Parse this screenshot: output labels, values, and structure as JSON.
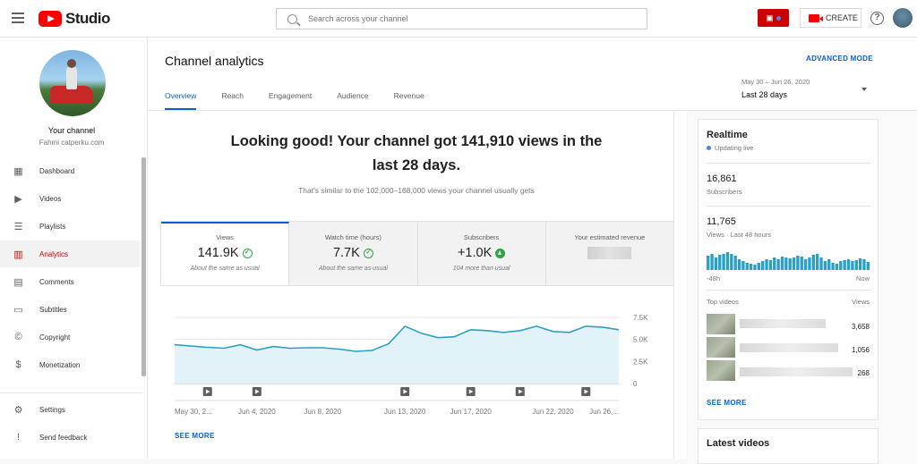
{
  "app": {
    "logo_text": "Studio"
  },
  "search": {
    "placeholder": "Search across your channel"
  },
  "header": {
    "create_label": "CREATE",
    "help_label": "?"
  },
  "sidebar": {
    "your_channel": "Your channel",
    "channel_name": "Fahmi catperku.com",
    "items": [
      {
        "label": "Dashboard",
        "icon": "dashboard-icon",
        "glyph": "▦"
      },
      {
        "label": "Videos",
        "icon": "videos-icon",
        "glyph": "▶"
      },
      {
        "label": "Playlists",
        "icon": "playlists-icon",
        "glyph": "☰"
      },
      {
        "label": "Analytics",
        "icon": "analytics-icon",
        "glyph": "▥",
        "active": true
      },
      {
        "label": "Comments",
        "icon": "comments-icon",
        "glyph": "▤"
      },
      {
        "label": "Subtitles",
        "icon": "subtitles-icon",
        "glyph": "▭"
      },
      {
        "label": "Copyright",
        "icon": "copyright-icon",
        "glyph": "©"
      },
      {
        "label": "Monetization",
        "icon": "monetization-icon",
        "glyph": "$"
      }
    ],
    "bottom_items": [
      {
        "label": "Settings",
        "icon": "settings-icon",
        "glyph": "⚙"
      },
      {
        "label": "Send feedback",
        "icon": "feedback-icon",
        "glyph": "!"
      }
    ]
  },
  "page": {
    "title": "Channel analytics",
    "advanced_mode": "ADVANCED MODE",
    "tabs": [
      "Overview",
      "Reach",
      "Engagement",
      "Audience",
      "Revenue"
    ],
    "date_range": "May 30 – Jun 26, 2020",
    "date_label": "Last 28 days"
  },
  "overview": {
    "headline": "Looking good! Your channel got 141,910 views in the last 28 days.",
    "subline": "That's similar to the 102,000–168,000 views your channel usually gets",
    "metrics": [
      {
        "label": "Views",
        "value": "141.9K",
        "note": "About the same as usual",
        "icon": "check-icon"
      },
      {
        "label": "Watch time (hours)",
        "value": "7.7K",
        "note": "About the same as usual",
        "icon": "check-icon"
      },
      {
        "label": "Subscribers",
        "value": "+1.0K",
        "note": "104 more than usual",
        "icon": "arrow-up-icon"
      },
      {
        "label": "Your estimated revenue",
        "value": "",
        "note": "",
        "icon": ""
      }
    ],
    "see_more": "SEE MORE"
  },
  "chart_data": {
    "type": "area",
    "x": [
      "May 30",
      "May 31",
      "Jun 1",
      "Jun 2",
      "Jun 3",
      "Jun 4",
      "Jun 5",
      "Jun 6",
      "Jun 7",
      "Jun 8",
      "Jun 9",
      "Jun 10",
      "Jun 11",
      "Jun 12",
      "Jun 13",
      "Jun 14",
      "Jun 15",
      "Jun 16",
      "Jun 17",
      "Jun 18",
      "Jun 19",
      "Jun 20",
      "Jun 21",
      "Jun 22",
      "Jun 23",
      "Jun 24",
      "Jun 25",
      "Jun 26"
    ],
    "values": [
      4400,
      4250,
      4100,
      4000,
      4400,
      3800,
      4200,
      4000,
      4050,
      4050,
      3900,
      3650,
      3750,
      4500,
      6500,
      5700,
      5200,
      5300,
      6100,
      6000,
      5800,
      6000,
      6500,
      5900,
      5800,
      6500,
      6400,
      6100
    ],
    "tick_labels_x": [
      "May 30, 2...",
      "Jun 4, 2020",
      "Jun 8, 2020",
      "Jun 13, 2020",
      "Jun 17, 2020",
      "Jun 22, 2020",
      "Jun 26,..."
    ],
    "tick_labels_y": [
      "7.5K",
      "5.0K",
      "2.5K",
      "0"
    ],
    "ylim": [
      0,
      7500
    ],
    "video_markers": [
      "Jun 1",
      "Jun 4",
      "Jun 13",
      "Jun 17",
      "Jun 20",
      "Jun 24"
    ],
    "color": "#2aa0c7",
    "fill": "#e1f3f9"
  },
  "realtime": {
    "title": "Realtime",
    "live": "Updating live",
    "subscribers_value": "16,861",
    "subscribers_label": "Subscribers",
    "views_value": "11,765",
    "views_label": "Views · Last 48 hours",
    "bars": [
      0.8,
      0.9,
      0.7,
      0.85,
      0.9,
      1.0,
      0.9,
      0.8,
      0.6,
      0.5,
      0.4,
      0.35,
      0.3,
      0.4,
      0.5,
      0.6,
      0.55,
      0.7,
      0.6,
      0.75,
      0.7,
      0.65,
      0.7,
      0.8,
      0.75,
      0.6,
      0.7,
      0.85,
      0.9,
      0.7,
      0.5,
      0.6,
      0.4,
      0.35,
      0.5,
      0.55,
      0.6,
      0.5,
      0.55,
      0.65,
      0.6,
      0.45
    ],
    "axis_left": "-48h",
    "axis_right": "Now",
    "top_videos_label": "Top videos",
    "views_col_label": "Views",
    "top_videos": [
      "3,658",
      "1,056",
      "268"
    ],
    "see_more": "SEE MORE"
  },
  "latest": {
    "title": "Latest videos"
  },
  "colors": {
    "accent": "#065fd4",
    "brand": "#ff0000",
    "positive": "#2ba640"
  }
}
